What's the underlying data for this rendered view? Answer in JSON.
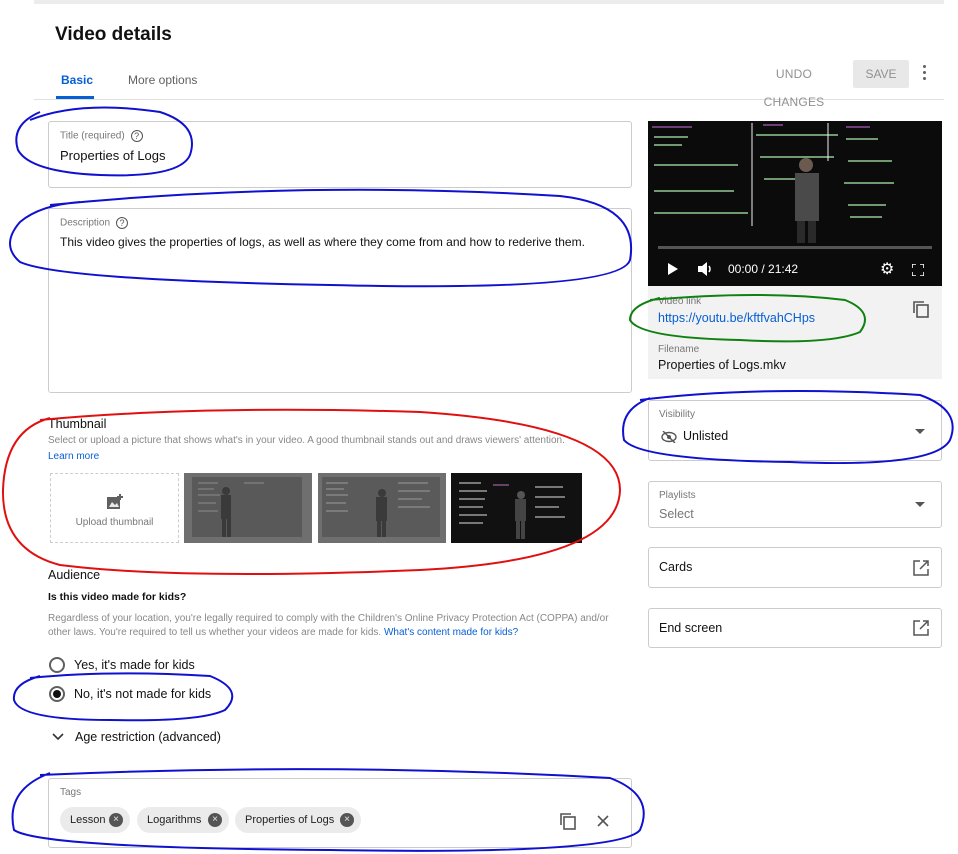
{
  "header": {
    "title": "Video details",
    "tabs": [
      "Basic",
      "More options"
    ],
    "undo_label": "UNDO CHANGES",
    "save_label": "SAVE"
  },
  "title_field": {
    "label": "Title (required)",
    "value": "Properties of Logs"
  },
  "description_field": {
    "label": "Description",
    "value": "This video gives the properties of logs, as well as where they come from and how to rederive them."
  },
  "thumbnail": {
    "title": "Thumbnail",
    "help": "Select or upload a picture that shows what's in your video. A good thumbnail stands out and draws viewers' attention.",
    "learn_more": "Learn more",
    "upload_label": "Upload thumbnail"
  },
  "audience": {
    "title": "Audience",
    "question": "Is this video made for kids?",
    "help": "Regardless of your location, you're legally required to comply with the Children's Online Privacy Protection Act (COPPA) and/or other laws. You're required to tell us whether your videos are made for kids.",
    "help_link": "What's content made for kids?",
    "option_yes": "Yes, it's made for kids",
    "option_no": "No, it's not made for kids",
    "selected": "no",
    "age_restriction": "Age restriction (advanced)"
  },
  "tags": {
    "label": "Tags",
    "items": [
      "Lesson",
      "Logarithms",
      "Properties of Logs"
    ]
  },
  "video": {
    "time": "00:00 / 21:42",
    "link_label": "Video link",
    "link": "https://youtu.be/kftfvahCHps",
    "filename_label": "Filename",
    "filename": "Properties of Logs.mkv"
  },
  "visibility": {
    "label": "Visibility",
    "value": "Unlisted"
  },
  "playlists": {
    "label": "Playlists",
    "value": "Select"
  },
  "cards_label": "Cards",
  "end_screen_label": "End screen",
  "colors": {
    "accent": "#065fd4",
    "blue_circle": "#1010d0",
    "red_circle": "#e01010",
    "green_circle": "#108010"
  }
}
